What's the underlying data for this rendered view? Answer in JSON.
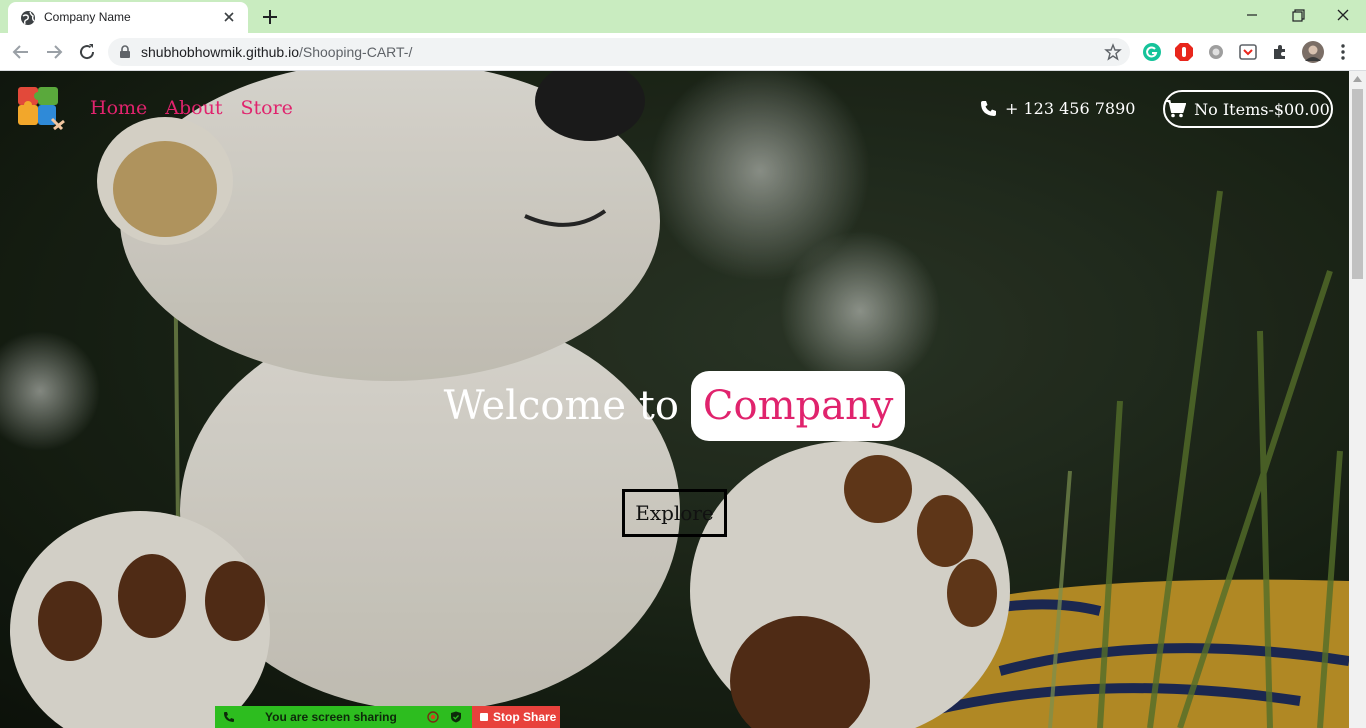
{
  "browser": {
    "tab_title": "Company Name",
    "url_host": "shubhobhowmik.github.io",
    "url_path": "/Shooping-CART-/"
  },
  "site": {
    "nav": [
      "Home",
      "About",
      "Store"
    ],
    "phone": "+ 123 456 7890",
    "cart_label": "No Items-$00.00",
    "welcome_lead": "Welcome to",
    "welcome_brand": "Company",
    "explore_label": "Explore"
  },
  "share_bar": {
    "status": "You are screen sharing",
    "stop_label": "Stop Share"
  },
  "colors": {
    "accent": "#e0236d",
    "tabstrip": "#c9ecc0",
    "share_green": "#2dbd1f",
    "share_red": "#e8413c"
  },
  "icons": [
    "globe-icon",
    "close-icon",
    "plus-icon",
    "minimize-icon",
    "restore-icon",
    "back-icon",
    "forward-icon",
    "reload-icon",
    "lock-icon",
    "star-icon",
    "grammarly-icon",
    "adblock-icon",
    "extension-icon",
    "puzzle-icon",
    "avatar",
    "phone-icon",
    "cart-icon"
  ]
}
